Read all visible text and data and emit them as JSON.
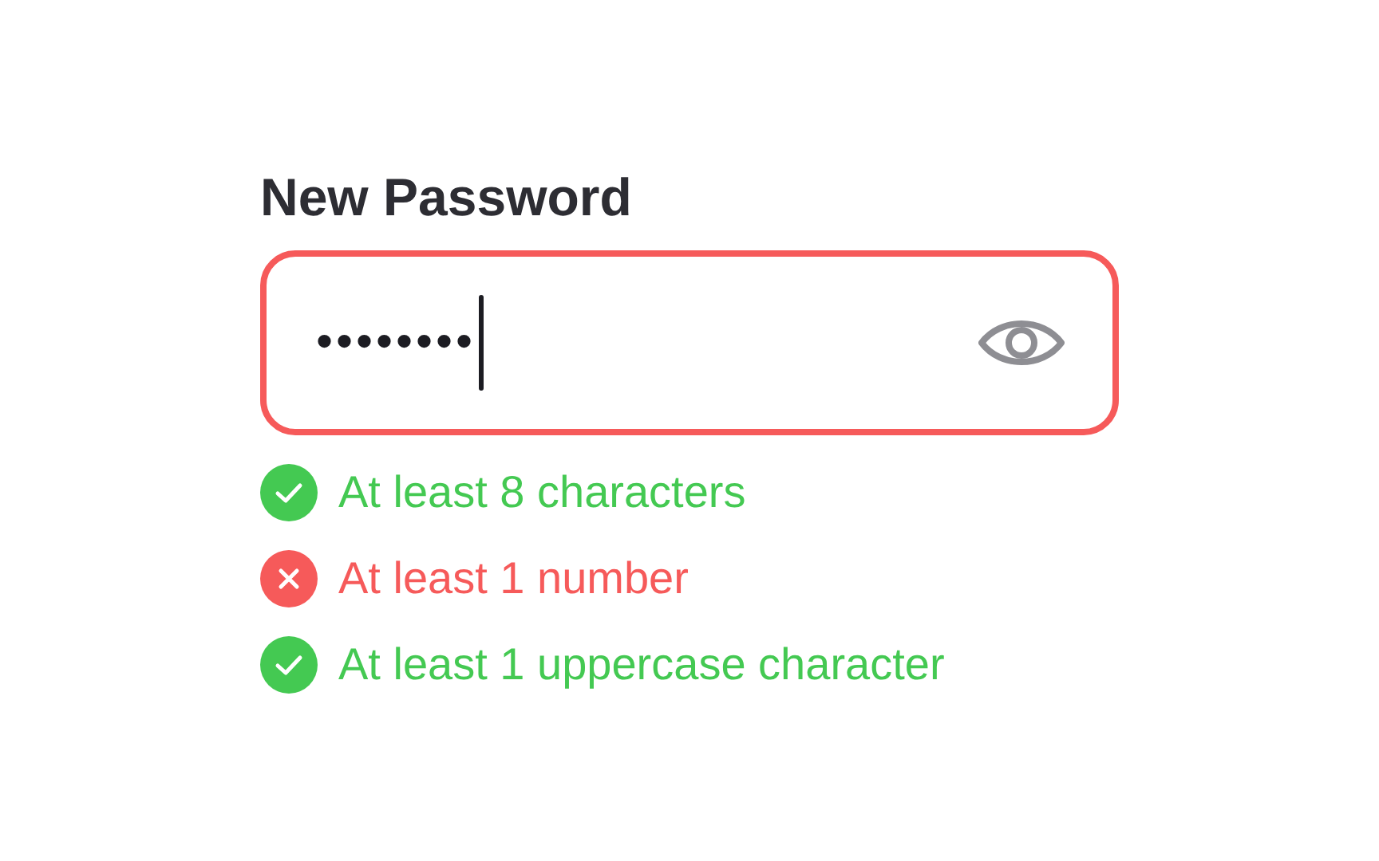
{
  "label": "New Password",
  "field": {
    "value": "••••••••",
    "error": true,
    "focused": true
  },
  "rules": [
    {
      "text": "At least 8 characters",
      "met": true
    },
    {
      "text": "At least 1 number",
      "met": false
    },
    {
      "text": "At least 1 uppercase character",
      "met": true
    }
  ]
}
